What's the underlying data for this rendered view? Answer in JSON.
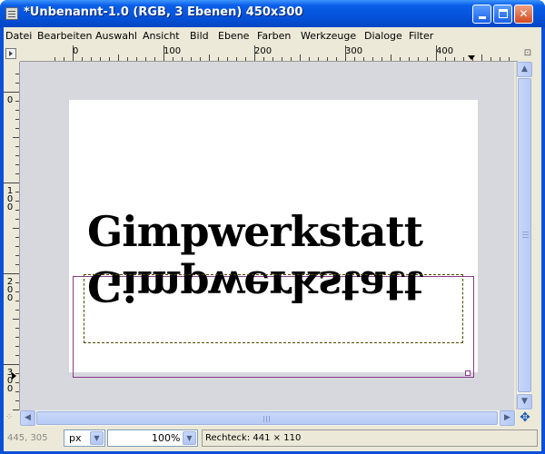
{
  "window": {
    "title": "*Unbenannt-1.0 (RGB, 3 Ebenen) 450x300",
    "minimize_label": "",
    "maximize_label": "",
    "close_label": "✕"
  },
  "menu": {
    "items": [
      {
        "label": "Datei"
      },
      {
        "label": "Bearbeiten"
      },
      {
        "label": "Auswahl"
      },
      {
        "label": "Ansicht"
      },
      {
        "label": "Bild"
      },
      {
        "label": "Ebene"
      },
      {
        "label": "Farben"
      },
      {
        "label": "Werkzeuge"
      },
      {
        "label": "Dialoge"
      },
      {
        "label": "Filter"
      }
    ]
  },
  "ruler": {
    "horizontal_labels": [
      "0",
      "100",
      "200",
      "300",
      "400"
    ],
    "vertical_labels": [
      "0",
      "100",
      "200",
      "300"
    ]
  },
  "canvas": {
    "text_upright": "Gimpwerkstatt",
    "text_flipped": "Gimpwerkstatt"
  },
  "icons": {
    "window_icon": "gimp-image-icon",
    "nav": "navigate-icon",
    "move": "move-cross-icon",
    "zoom_toggle": "zoom-toggle-icon"
  },
  "statusbar": {
    "coords": "445, 305",
    "unit": "px",
    "zoom": "100%",
    "message": "Rechteck: 441 × 110"
  },
  "colors": {
    "titlebar": "#0453db",
    "chrome": "#ece9d8",
    "canvas_bg": "#d7d7de",
    "layer_boundary": "#8a3a8a"
  }
}
